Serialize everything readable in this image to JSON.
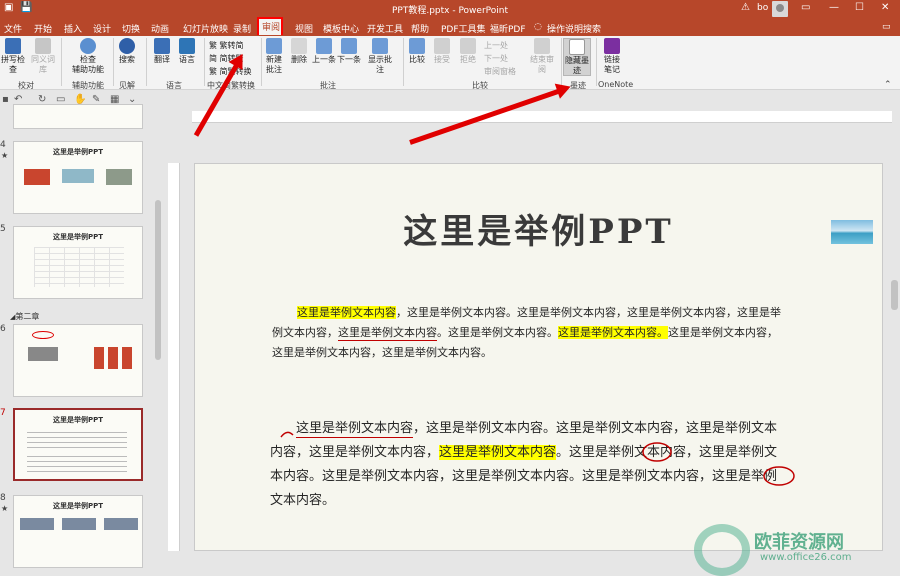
{
  "window": {
    "title": "PPT教程.pptx - PowerPoint",
    "user": "bo"
  },
  "tabs": [
    "文件",
    "开始",
    "插入",
    "设计",
    "切换",
    "动画",
    "幻灯片放映",
    "录制",
    "审阅",
    "视图",
    "模板中心",
    "开发工具",
    "帮助",
    "PDF工具集",
    "福昕PDF",
    "操作说明搜索"
  ],
  "active_tab": "审阅",
  "ribbon": {
    "spell": "拼写检查",
    "thesaurus": "同义词库",
    "check_access_1": "检查",
    "check_access_2": "辅助功能",
    "search": "搜索",
    "translate": "翻译",
    "language": "语言",
    "to_trad": "繁转简",
    "to_simp": "简转繁",
    "convert": "简繁转换",
    "new_comment_1": "新建",
    "new_comment_2": "批注",
    "delete": "删除",
    "prev": "上一条",
    "next": "下一条",
    "show_comments": "显示批注",
    "compare": "比较",
    "accept": "接受",
    "reject": "拒绝",
    "prev_change": "上一处",
    "next_change": "下一处",
    "review_pane": "审阅窗格",
    "end_review": "结束审阅",
    "hide_ink_1": "隐藏墨",
    "hide_ink_2": "迹",
    "onenote_1": "链接",
    "onenote_2": "笔记",
    "groups": {
      "proofing": "校对",
      "accessibility": "辅助功能",
      "insights": "见解",
      "language": "语言",
      "chinese": "中文简繁转换",
      "comments": "批注",
      "compare": "比较",
      "ink": "墨迹",
      "onenote": "OneNote"
    }
  },
  "thumbnails": [
    {
      "num": "4",
      "title": "这里是举例PPT"
    },
    {
      "num": "5",
      "title": "这里是举例PPT"
    },
    {
      "num": "6",
      "title": ""
    },
    {
      "num": "7",
      "title": "这里是举例PPT"
    },
    {
      "num": "8",
      "title": "这里是举例PPT"
    }
  ],
  "section": "第二章",
  "slide": {
    "title": "这里是举例PPT",
    "p1": {
      "l1a": "这里是举例文本内容",
      "l1b": "，这里是举例文本内容。这里是举例文本内容，这里是举例文本内容，这里是举",
      "l2a": "例文本内容，",
      "l2b": "这里是举例文本内容",
      "l2c": "。这里是举例文本内容。",
      "l2d": "这里是举例文本内容。",
      "l2e": "这里是举例文本内容，",
      "l3": "这里是举例文本内容，这里是举例文本内容。"
    },
    "p2": {
      "l1a": "这里是举例文本内容",
      "l1b": "，这里是举例文本内容。这里是举例文本内容，这里是举例文本",
      "l2a": "内容，这里是举例文本内容，",
      "l2b": "这里是举例文本内容",
      "l2c": "。这里是举例文本内容，这里是举例文",
      "l3": "本内容。这里是举例文本内容，这里是举例文本内容。这里是举例文本内容，这里是举例",
      "l4": "文本内容。"
    }
  },
  "watermark": {
    "text": "欧菲资源网",
    "url": "www.office26.com"
  }
}
